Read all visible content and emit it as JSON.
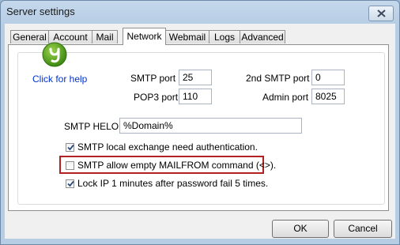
{
  "window": {
    "title": "Server settings"
  },
  "tabs": [
    {
      "label": "General"
    },
    {
      "label": "Account"
    },
    {
      "label": "Mail"
    },
    {
      "label": "Network",
      "active": true
    },
    {
      "label": "Webmail"
    },
    {
      "label": "Logs"
    },
    {
      "label": "Advanced"
    }
  ],
  "help": {
    "link_label": "Click for help",
    "icon": "help-logo-icon"
  },
  "fields": {
    "smtp_port": {
      "label": "SMTP port",
      "value": "25"
    },
    "second_smtp_port": {
      "label": "2nd SMTP port",
      "value": "0"
    },
    "pop3_port": {
      "label": "POP3 port",
      "value": "110"
    },
    "admin_port": {
      "label": "Admin port",
      "value": "8025"
    },
    "smtp_helo": {
      "label": "SMTP HELO",
      "value": "%Domain%"
    }
  },
  "checkboxes": [
    {
      "label": "SMTP local exchange need authentication.",
      "checked": true
    },
    {
      "label": "SMTP allow empty MAILFROM command (<>).",
      "checked": false
    },
    {
      "label": "Lock IP 1 minutes after password fail 5 times.",
      "checked": true
    }
  ],
  "buttons": {
    "ok": "OK",
    "cancel": "Cancel"
  },
  "colors": {
    "highlight": "#b22222",
    "link": "#0033cc",
    "logo": "#5aa51e"
  }
}
